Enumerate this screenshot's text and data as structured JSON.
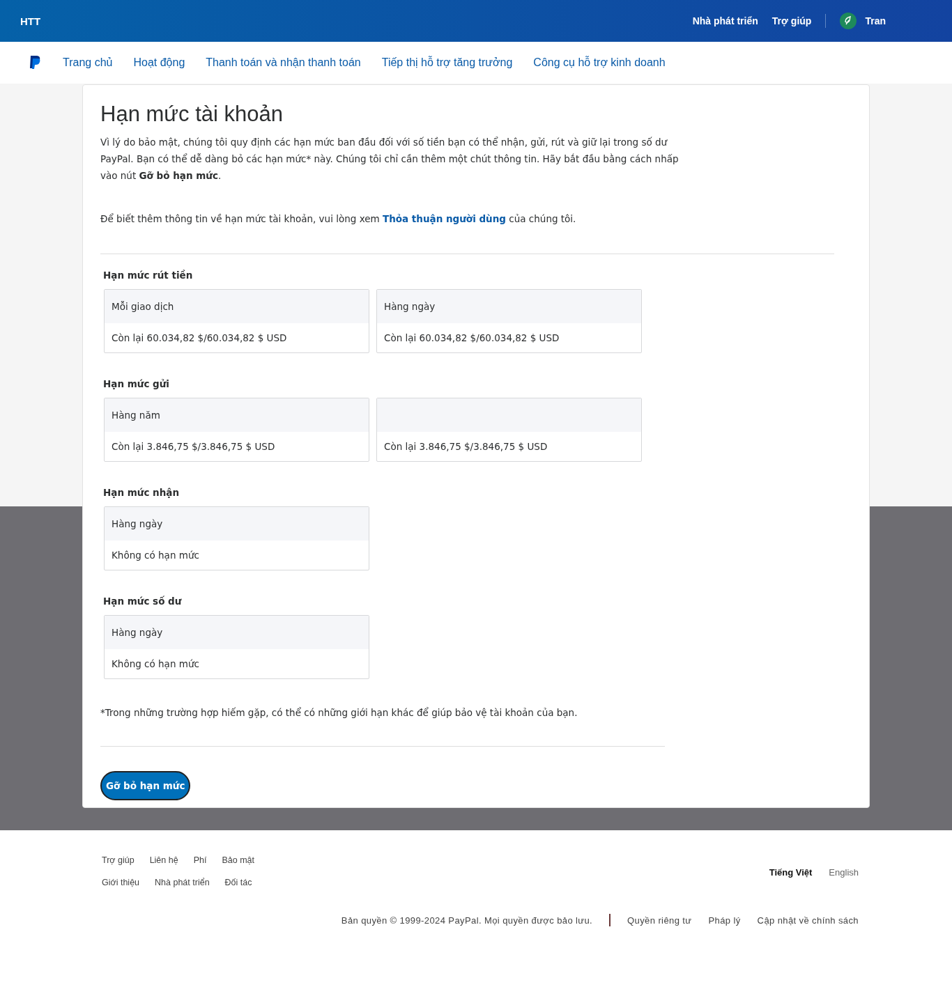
{
  "topbar": {
    "brand": "HTT",
    "links": [
      "Nhà phát triển",
      "Trợ giúp"
    ],
    "user": "Tran"
  },
  "nav": [
    "Trang chủ",
    "Hoạt động",
    "Thanh toán và nhận thanh toán",
    "Tiếp thị hỗ trợ tăng trưởng",
    "Công cụ hỗ trợ kinh doanh"
  ],
  "title": "Hạn mức tài khoản",
  "intro": "Vì lý do bảo mật, chúng tôi quy định các hạn mức ban đầu đối với số tiền bạn có thể nhận, gửi, rút và giữ lại trong số dư PayPal. Bạn có thể dễ dàng bỏ các hạn mức* này. Chúng tôi chỉ cần thêm một chút thông tin. Hãy bắt đầu bằng cách nhấp vào nút **Gỡ bỏ hạn mức**.",
  "more_info": {
    "before": "Để biết thêm thông tin về hạn mức tài khoản, vui lòng xem",
    "link": "Thỏa thuận người dùng",
    "after": "của chúng tôi."
  },
  "sections": [
    {
      "heading": "Hạn mức rút tiền",
      "cards": [
        {
          "period": "Mỗi giao dịch",
          "value": "Còn lại 60.034,82 $/60.034,82 $ USD"
        },
        {
          "period": "Hàng ngày",
          "value": "Còn lại 60.034,82 $/60.034,82 $ USD"
        }
      ]
    },
    {
      "heading": "Hạn mức gửi",
      "cards": [
        {
          "period": "Hàng năm",
          "value": "Còn lại 3.846,75 $/3.846,75 $ USD"
        },
        {
          "value": "Còn lại 3.846,75 $/3.846,75 $ USD"
        }
      ]
    },
    {
      "heading": "Hạn mức nhận",
      "cards": [
        {
          "period": "Hàng ngày",
          "value": "Không có hạn mức"
        }
      ]
    },
    {
      "heading": "Hạn mức số dư",
      "cards": [
        {
          "period": "Hàng ngày",
          "value": "Không có hạn mức"
        }
      ]
    }
  ],
  "footnote": "*Trong những trường hợp hiếm gặp, có thể có những giới hạn khác để giúp bảo vệ tài khoản của bạn.",
  "button": "Gỡ bỏ hạn mức",
  "footer": {
    "link_groups": [
      {
        "links": [
          "Trợ giúp",
          "Liên hệ",
          "Phí",
          "Bảo mật"
        ]
      },
      {
        "links": [
          "Giới thiệu",
          "Nhà phát triển",
          "Đối tác"
        ]
      }
    ],
    "languages": [
      {
        "label": "Tiếng Việt",
        "selected": true
      },
      {
        "label": "English",
        "selected": false
      }
    ],
    "copyright": "Bản quyền © 1999-2024 PayPal. Mọi quyền được bảo lưu.",
    "legal": [
      "Quyền riêng tư",
      "Pháp lý",
      "Cập nhật về chính sách"
    ]
  }
}
